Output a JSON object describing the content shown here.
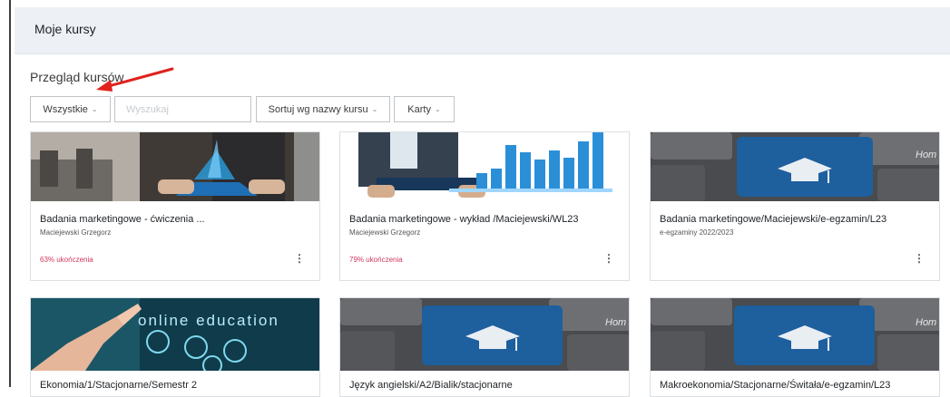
{
  "header": {
    "title": "Moje kursy"
  },
  "overview": {
    "title": "Przegląd kursów",
    "filter_label": "Wszystkie",
    "search_placeholder": "Wyszukaj",
    "sort_label": "Sortuj wg nazwy kursu",
    "view_label": "Karty"
  },
  "colors": {
    "accent_progress": "#d0395e",
    "header_bg": "#edf0f5",
    "arrow": "#e0211d"
  },
  "courses": [
    {
      "title": "Badania marketingowe - ćwiczenia ...",
      "subtitle": "Maciejewski Grzegorz",
      "progress": "63% ukończenia",
      "progress_value": 63,
      "image": "tablet-hands"
    },
    {
      "title": "Badania marketingowe - wykład /Maciejewski/WL23",
      "subtitle": "Maciejewski Grzegorz",
      "progress": "79% ukończenia",
      "progress_value": 79,
      "image": "bar-chart-hands"
    },
    {
      "title": "Badania marketingowe/Maciejewski/e-egzamin/L23",
      "subtitle": "e-egzaminy 2022/2023",
      "progress": "",
      "image": "keyboard-graduation"
    },
    {
      "title": "Ekonomia/1/Stacjonarne/Semestr 2",
      "subtitle": "",
      "progress": "",
      "image": "online-education"
    },
    {
      "title": "Język angielski/A2/Bialik/stacjonarne",
      "subtitle": "",
      "progress": "",
      "image": "keyboard-graduation"
    },
    {
      "title": "Makroekonomia/Stacjonarne/Świtała/e-egzamin/L23",
      "subtitle": "",
      "progress": "",
      "image": "keyboard-graduation"
    }
  ],
  "images": {
    "online_education_text": "online education",
    "keyboard_key_text": "Hom"
  }
}
